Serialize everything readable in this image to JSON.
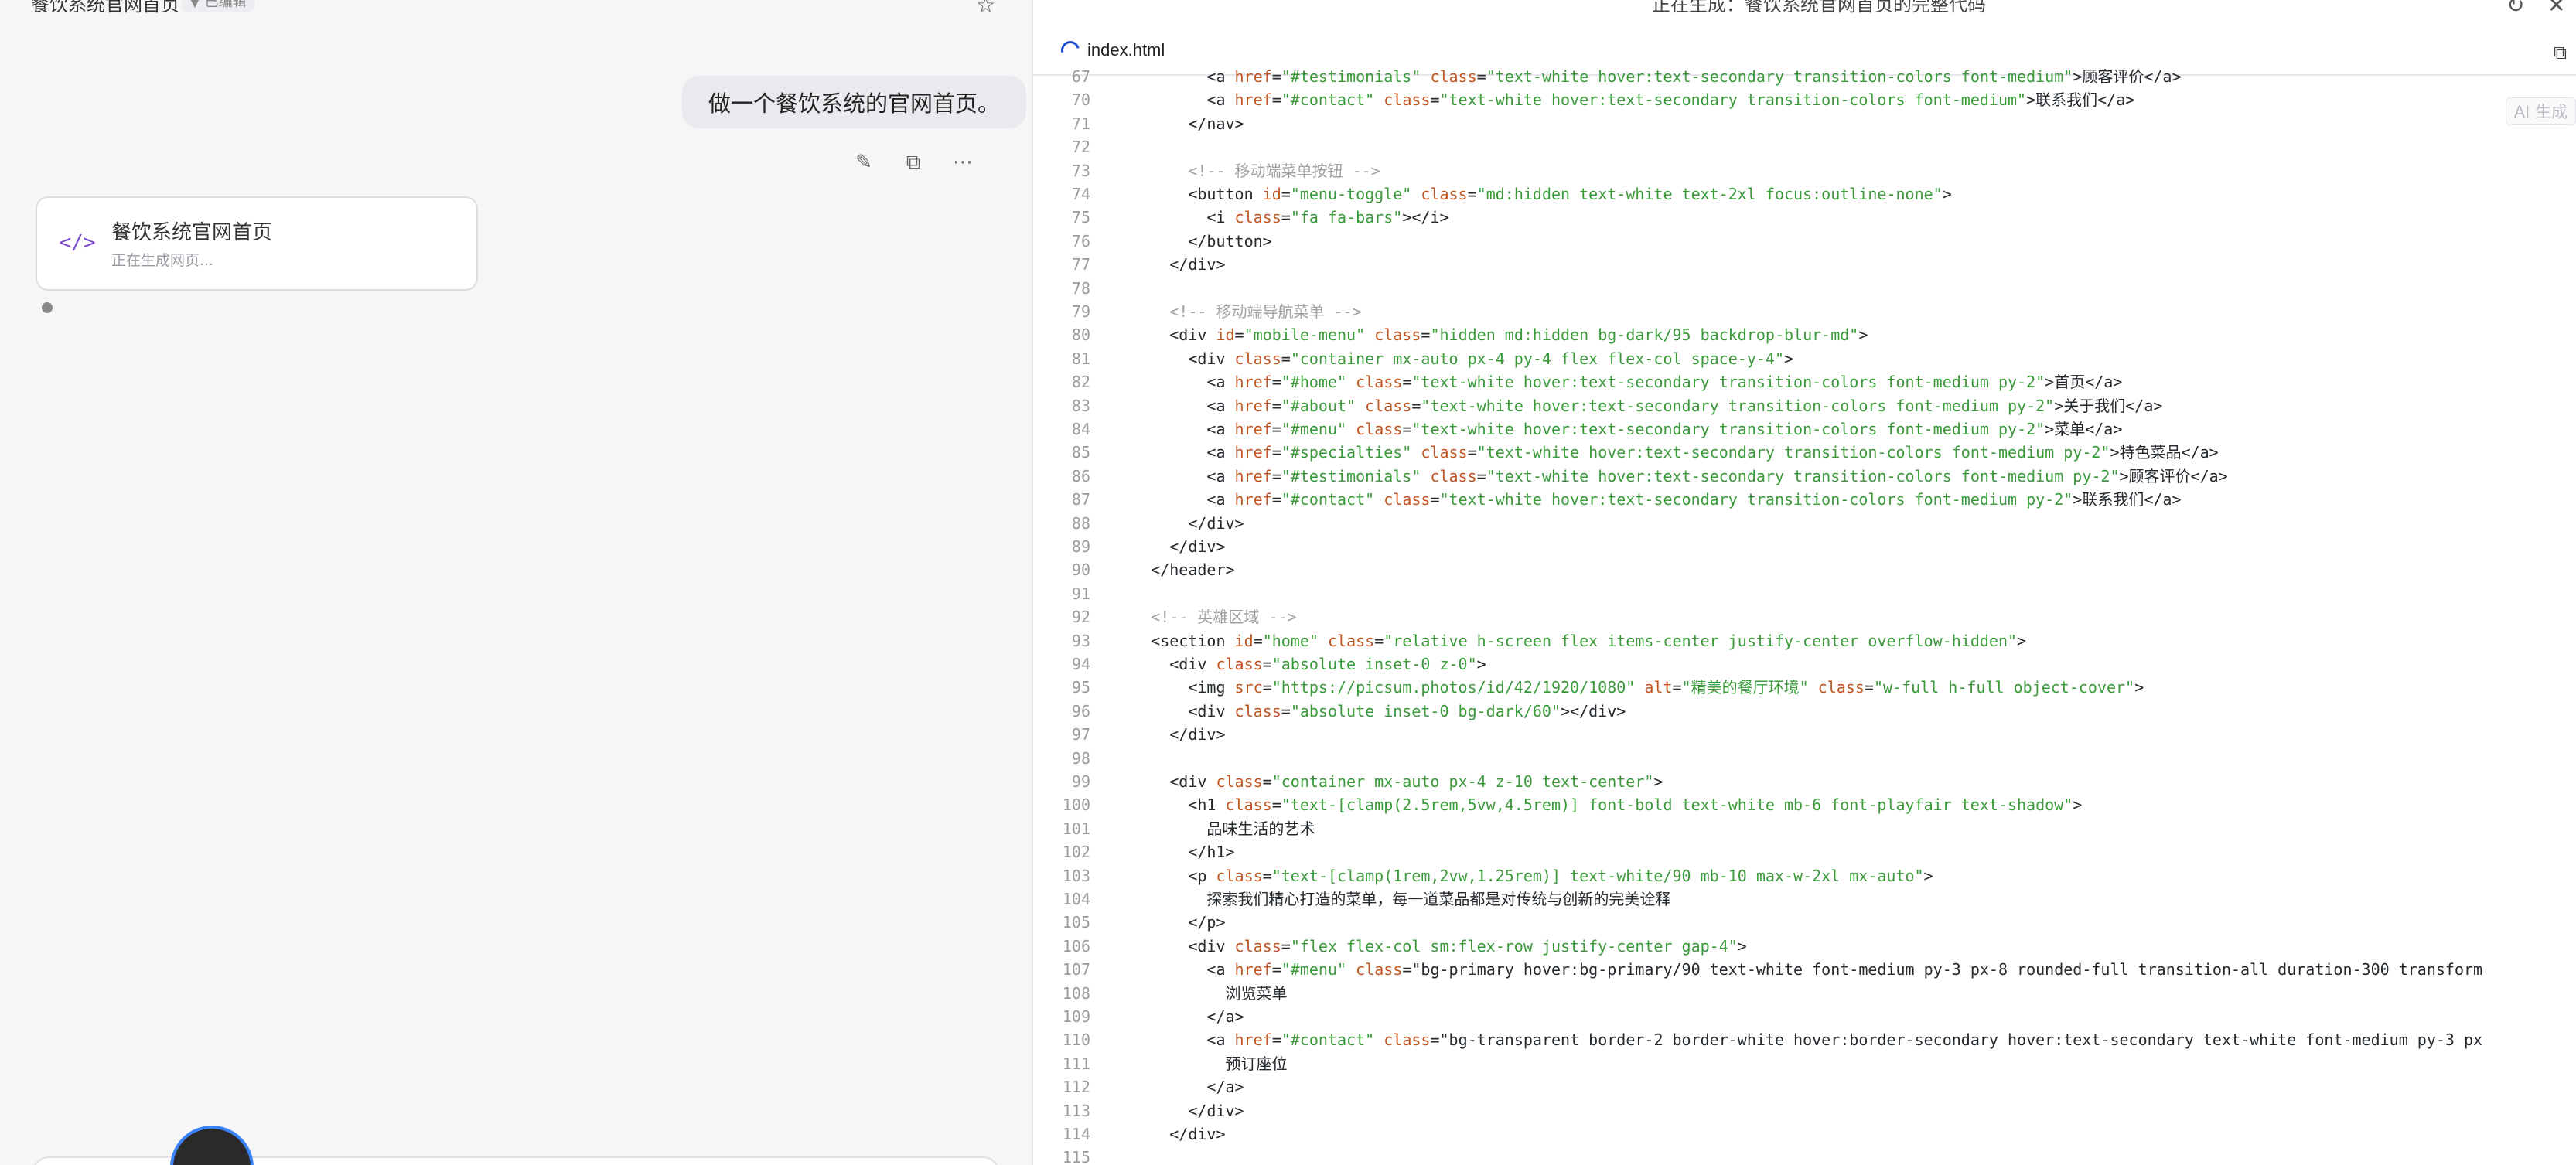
{
  "header": {
    "title": "餐饮系统官网首页",
    "badge": "▼ 已编辑",
    "status": "正在生成：餐饮系统官网首页的完整代码"
  },
  "chat": {
    "user_message": "做一个餐饮系统的官网首页。",
    "card_title": "餐饮系统官网首页",
    "card_subtitle": "正在生成网页..."
  },
  "editor": {
    "filename": "index.html",
    "ai_badge": "AI 生成",
    "lines": [
      {
        "n": "67",
        "t": "          <a href=\"#testimonials\" class=\"text-white hover:text-secondary transition-colors font-medium\">顾客评价</a>"
      },
      {
        "n": "70",
        "t": "          <a href=\"#contact\" class=\"text-white hover:text-secondary transition-colors font-medium\">联系我们</a>"
      },
      {
        "n": "71",
        "t": "        </nav>"
      },
      {
        "n": "72",
        "t": ""
      },
      {
        "n": "73",
        "t": "        <!-- 移动端菜单按钮 -->"
      },
      {
        "n": "74",
        "t": "        <button id=\"menu-toggle\" class=\"md:hidden text-white text-2xl focus:outline-none\">"
      },
      {
        "n": "75",
        "t": "          <i class=\"fa fa-bars\"></i>"
      },
      {
        "n": "76",
        "t": "        </button>"
      },
      {
        "n": "77",
        "t": "      </div>"
      },
      {
        "n": "78",
        "t": ""
      },
      {
        "n": "79",
        "t": "      <!-- 移动端导航菜单 -->"
      },
      {
        "n": "80",
        "t": "      <div id=\"mobile-menu\" class=\"hidden md:hidden bg-dark/95 backdrop-blur-md\">"
      },
      {
        "n": "81",
        "t": "        <div class=\"container mx-auto px-4 py-4 flex flex-col space-y-4\">"
      },
      {
        "n": "82",
        "t": "          <a href=\"#home\" class=\"text-white hover:text-secondary transition-colors font-medium py-2\">首页</a>"
      },
      {
        "n": "83",
        "t": "          <a href=\"#about\" class=\"text-white hover:text-secondary transition-colors font-medium py-2\">关于我们</a>"
      },
      {
        "n": "84",
        "t": "          <a href=\"#menu\" class=\"text-white hover:text-secondary transition-colors font-medium py-2\">菜单</a>"
      },
      {
        "n": "85",
        "t": "          <a href=\"#specialties\" class=\"text-white hover:text-secondary transition-colors font-medium py-2\">特色菜品</a>"
      },
      {
        "n": "86",
        "t": "          <a href=\"#testimonials\" class=\"text-white hover:text-secondary transition-colors font-medium py-2\">顾客评价</a>"
      },
      {
        "n": "87",
        "t": "          <a href=\"#contact\" class=\"text-white hover:text-secondary transition-colors font-medium py-2\">联系我们</a>"
      },
      {
        "n": "88",
        "t": "        </div>"
      },
      {
        "n": "89",
        "t": "      </div>"
      },
      {
        "n": "90",
        "t": "    </header>"
      },
      {
        "n": "91",
        "t": ""
      },
      {
        "n": "92",
        "t": "    <!-- 英雄区域 -->"
      },
      {
        "n": "93",
        "t": "    <section id=\"home\" class=\"relative h-screen flex items-center justify-center overflow-hidden\">"
      },
      {
        "n": "94",
        "t": "      <div class=\"absolute inset-0 z-0\">"
      },
      {
        "n": "95",
        "t": "        <img src=\"https://picsum.photos/id/42/1920/1080\" alt=\"精美的餐厅环境\" class=\"w-full h-full object-cover\">"
      },
      {
        "n": "96",
        "t": "        <div class=\"absolute inset-0 bg-dark/60\"></div>"
      },
      {
        "n": "97",
        "t": "      </div>"
      },
      {
        "n": "98",
        "t": ""
      },
      {
        "n": "99",
        "t": "      <div class=\"container mx-auto px-4 z-10 text-center\">"
      },
      {
        "n": "100",
        "t": "        <h1 class=\"text-[clamp(2.5rem,5vw,4.5rem)] font-bold text-white mb-6 font-playfair text-shadow\">"
      },
      {
        "n": "101",
        "t": "          品味生活的艺术"
      },
      {
        "n": "102",
        "t": "        </h1>"
      },
      {
        "n": "103",
        "t": "        <p class=\"text-[clamp(1rem,2vw,1.25rem)] text-white/90 mb-10 max-w-2xl mx-auto\">"
      },
      {
        "n": "104",
        "t": "          探索我们精心打造的菜单，每一道菜品都是对传统与创新的完美诠释"
      },
      {
        "n": "105",
        "t": "        </p>"
      },
      {
        "n": "106",
        "t": "        <div class=\"flex flex-col sm:flex-row justify-center gap-4\">"
      },
      {
        "n": "107",
        "t": "          <a href=\"#menu\" class=\"bg-primary hover:bg-primary/90 text-white font-medium py-3 px-8 rounded-full transition-all duration-300 transform"
      },
      {
        "n": "108",
        "t": "            浏览菜单"
      },
      {
        "n": "109",
        "t": "          </a>"
      },
      {
        "n": "110",
        "t": "          <a href=\"#contact\" class=\"bg-transparent border-2 border-white hover:border-secondary hover:text-secondary text-white font-medium py-3 px"
      },
      {
        "n": "111",
        "t": "            预订座位"
      },
      {
        "n": "112",
        "t": "          </a>"
      },
      {
        "n": "113",
        "t": "        </div>"
      },
      {
        "n": "114",
        "t": "      </div>"
      },
      {
        "n": "115",
        "t": ""
      }
    ]
  }
}
